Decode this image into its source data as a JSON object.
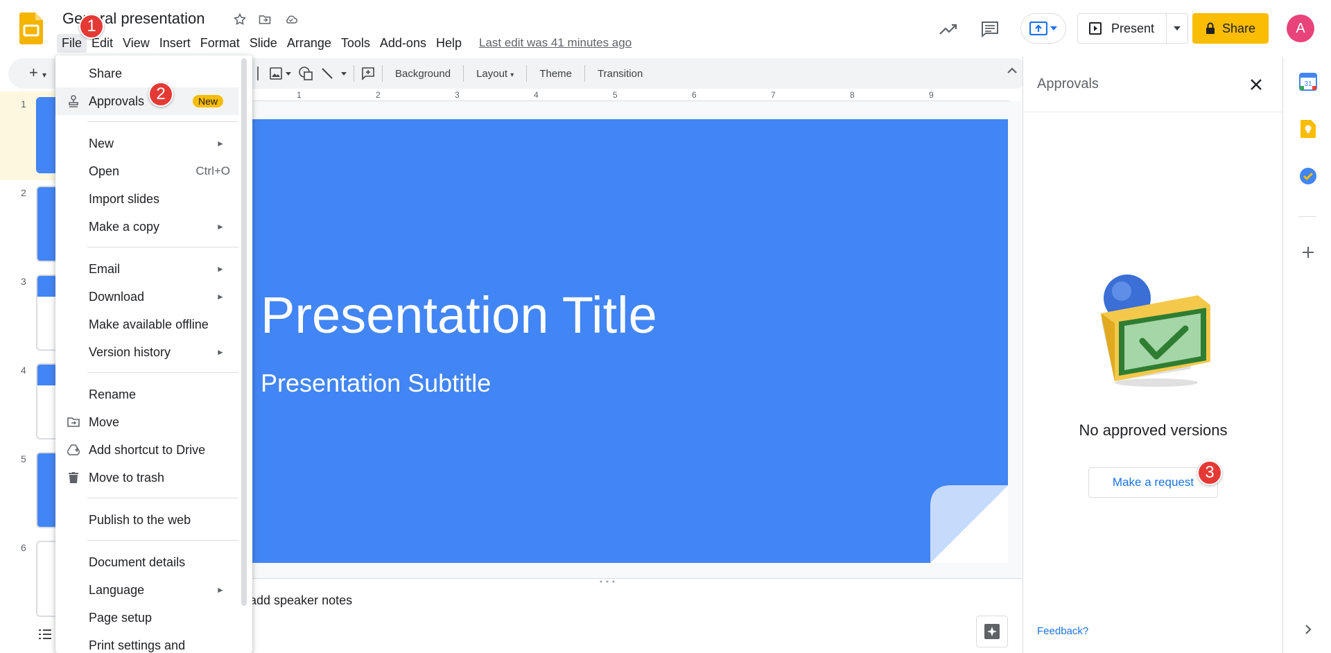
{
  "header": {
    "title": "General presentation",
    "last_edit": "Last edit was 41 minutes ago",
    "present_label": "Present",
    "share_label": "Share",
    "avatar_initial": "A"
  },
  "menubar": [
    "File",
    "Edit",
    "View",
    "Insert",
    "Format",
    "Slide",
    "Arrange",
    "Tools",
    "Add-ons",
    "Help"
  ],
  "toolbar": {
    "background": "Background",
    "layout": "Layout",
    "theme": "Theme",
    "transition": "Transition"
  },
  "filmstrip": [
    "1",
    "2",
    "3",
    "4",
    "5",
    "6"
  ],
  "ruler": [
    "1",
    "2",
    "3",
    "4",
    "5",
    "6",
    "7",
    "8",
    "9"
  ],
  "slide": {
    "title": "Presentation Title",
    "subtitle": "Presentation Subtitle"
  },
  "notes": {
    "placeholder": "add speaker notes"
  },
  "approvals": {
    "title": "Approvals",
    "empty_message": "No approved versions",
    "request_button": "Make a request",
    "feedback": "Feedback?"
  },
  "file_menu": {
    "share": "Share",
    "approvals": "Approvals",
    "approvals_badge": "New",
    "new": "New",
    "open": "Open",
    "open_shortcut": "Ctrl+O",
    "import_slides": "Import slides",
    "make_copy": "Make a copy",
    "email": "Email",
    "download": "Download",
    "offline": "Make available offline",
    "version_history": "Version history",
    "rename": "Rename",
    "move": "Move",
    "add_shortcut": "Add shortcut to Drive",
    "trash": "Move to trash",
    "publish": "Publish to the web",
    "details": "Document details",
    "language": "Language",
    "page_setup": "Page setup",
    "print_settings": "Print settings and"
  },
  "steps": [
    "1",
    "2",
    "3"
  ],
  "colors": {
    "accent_blue": "#4285f4",
    "share_yellow": "#fbbc04",
    "marker_red": "#e53935",
    "avatar_pink": "#e8437a"
  }
}
